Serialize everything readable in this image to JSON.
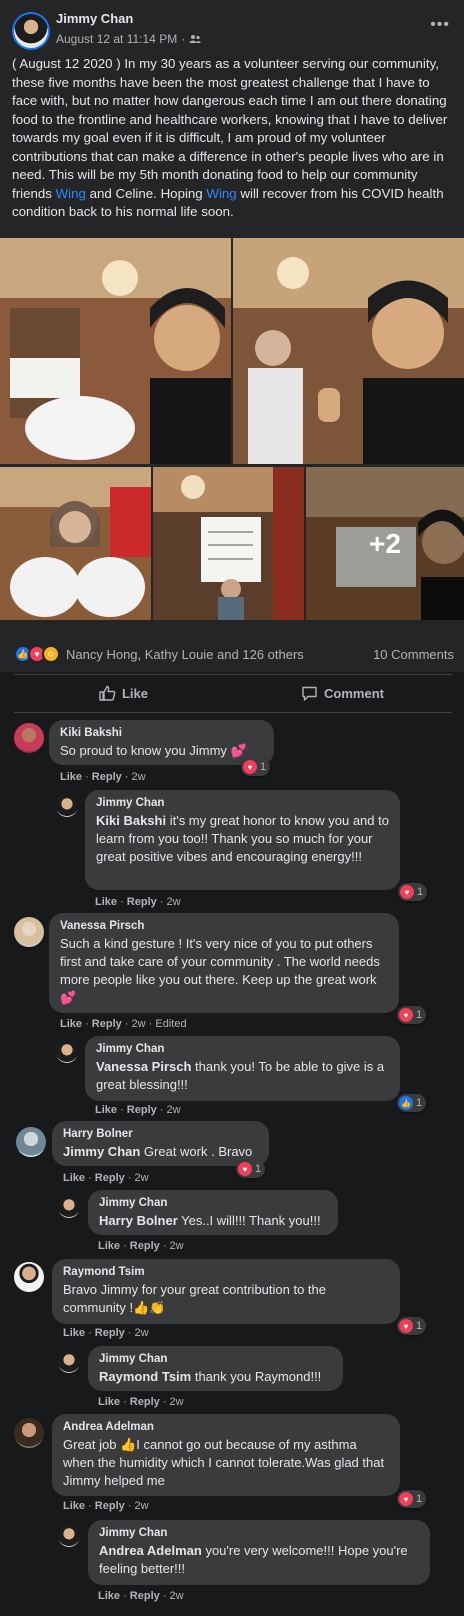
{
  "post": {
    "author": "Jimmy Chan",
    "timestamp": "August 12 at 11:14 PM",
    "privacy_icon": "friends-icon",
    "text_part1": "( August 12 2020 ) In my 30 years as a volunteer serving our community, these five months have been the most greatest challenge that I have to face with,  but no matter how dangerous each time I am out there donating food to the frontline and healthcare workers, knowing that I have to deliver towards my goal even if it is difficult, I am proud of my volunteer contributions that can make a difference in other's people lives who are in need. This will be my 5th month donating food to help our community friends ",
    "link1": "Wing",
    "text_part2": " and Celine. Hoping ",
    "link2": "Wing",
    "text_part3": " will recover from his COVID health condition back to his normal life soon.",
    "more_photos": "+2"
  },
  "reactions": {
    "summary": "Nancy Hong, Kathy Louie and 126 others",
    "comments_count": "10 Comments"
  },
  "actions": {
    "like": "Like",
    "comment": "Comment"
  },
  "comments": [
    {
      "name": "Kiki Bakshi",
      "text": "So proud to know you Jimmy 💕",
      "like": "Like",
      "reply": "Reply",
      "time": "2w",
      "reaction_count": "1"
    },
    {
      "name": "Jimmy Chan",
      "tag": "Kiki Bakshi",
      "text": " it's my great honor to know you and to learn from you too!! Thank you so much for your great positive vibes and encouraging energy!!!",
      "like": "Like",
      "reply": "Reply",
      "time": "2w",
      "reaction_count": "1"
    },
    {
      "name": "Vanessa Pirsch",
      "text": "Such a kind gesture ! It's very nice of you to put others first and take care of your community . The world needs more people like you out there. Keep up the great work 💕",
      "like": "Like",
      "reply": "Reply",
      "time": "2w",
      "edited": "Edited",
      "reaction_count": "1"
    },
    {
      "name": "Jimmy Chan",
      "tag": "Vanessa Pirsch",
      "text": " thank you! To be able to give is a great blessing!!!",
      "like": "Like",
      "reply": "Reply",
      "time": "2w",
      "reaction_count": "1"
    },
    {
      "name": "Harry Bolner",
      "tag": "Jimmy Chan",
      "text": " Great work . Bravo",
      "like": "Like",
      "reply": "Reply",
      "time": "2w",
      "reaction_count": "1"
    },
    {
      "name": "Jimmy Chan",
      "tag": "Harry Bolner",
      "text": " Yes..I will!!! Thank you!!!",
      "like": "Like",
      "reply": "Reply",
      "time": "2w"
    },
    {
      "name": "Raymond Tsim",
      "text": "Bravo Jimmy for your great contribution to the community !👍👏",
      "like": "Like",
      "reply": "Reply",
      "time": "2w",
      "reaction_count": "1"
    },
    {
      "name": "Jimmy Chan",
      "tag": "Raymond Tsim",
      "text": " thank you Raymond!!!",
      "like": "Like",
      "reply": "Reply",
      "time": "2w"
    },
    {
      "name": "Andrea Adelman",
      "text": "Great job 👍I cannot go out because of my asthma when the humidity which I cannot tolerate.Was glad that Jimmy helped me",
      "like": "Like",
      "reply": "Reply",
      "time": "2w",
      "reaction_count": "1"
    },
    {
      "name": "Jimmy Chan",
      "tag": "Andrea Adelman",
      "text": " you're very welcome!!! Hope you're feeling better!!!",
      "like": "Like",
      "reply": "Reply",
      "time": "2w"
    }
  ]
}
